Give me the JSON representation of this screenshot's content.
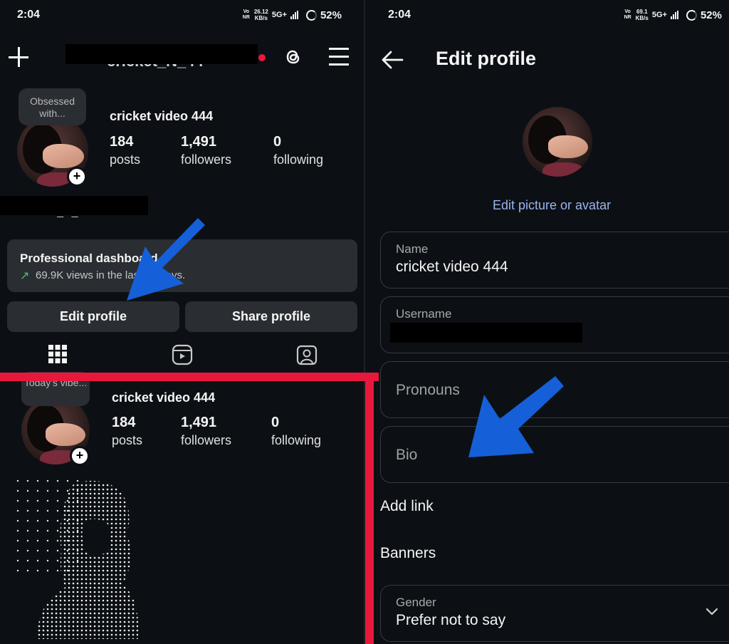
{
  "left": {
    "status": {
      "time": "2:04",
      "volte": "Vo NR",
      "speed_value": "26.12",
      "speed_unit": "KB/s",
      "network": "5G+",
      "battery": "52%"
    },
    "header": {
      "username_fragment": "cricket_N_44"
    },
    "profile": {
      "note": "Obsessed with...",
      "display_name": "cricket video 444",
      "posts_count": "184",
      "posts_label": "posts",
      "followers_count": "1,491",
      "followers_label": "followers",
      "following_count": "0",
      "following_label": "following",
      "threads_fragment": "cricket_N_44"
    },
    "dashboard": {
      "title": "Professional dashboard",
      "views_text": "69.9K views in the last 30 days."
    },
    "buttons": {
      "edit_profile": "Edit profile",
      "share_profile": "Share profile"
    },
    "profile2": {
      "note": "Today's vibe...",
      "display_name": "cricket video 444",
      "posts_count": "184",
      "posts_label": "posts",
      "followers_count": "1,491",
      "followers_label": "followers",
      "following_count": "0",
      "following_label": "following"
    }
  },
  "right": {
    "status": {
      "time": "2:04",
      "volte": "Vo NR",
      "speed_value": "69.1",
      "speed_unit": "KB/s",
      "network": "5G+",
      "battery": "52%"
    },
    "title": "Edit profile",
    "edit_picture_link": "Edit picture or avatar",
    "fields": {
      "name_label": "Name",
      "name_value": "cricket video 444",
      "username_label": "Username",
      "pronouns_placeholder": "Pronouns",
      "bio_placeholder": "Bio",
      "add_link": "Add link",
      "banners": "Banners",
      "gender_label": "Gender",
      "gender_value": "Prefer not to say"
    }
  },
  "colors": {
    "background": "#0c1014",
    "surface": "#2a2e33",
    "link": "#9ab4f0",
    "annotation_red": "#e8183c",
    "annotation_blue": "#1560d8",
    "growth_green": "#4fbf67"
  }
}
